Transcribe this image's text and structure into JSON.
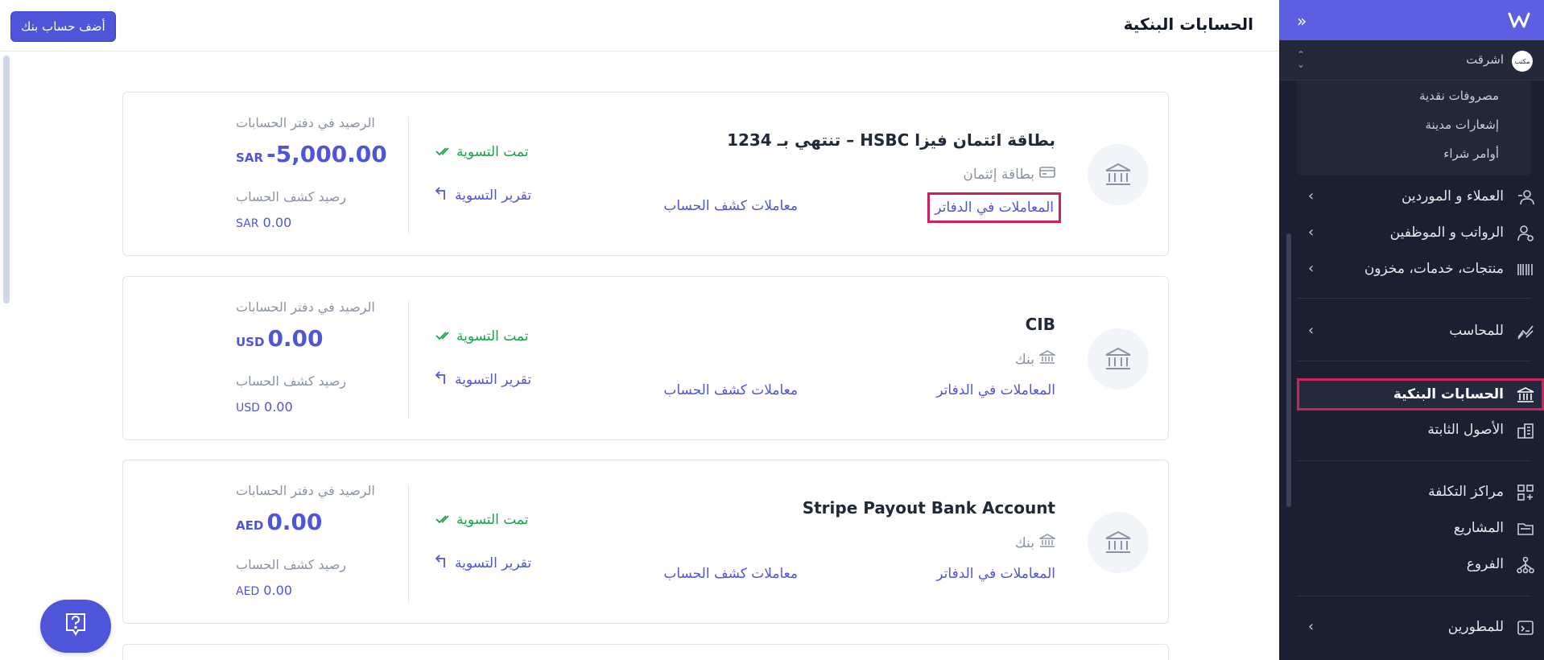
{
  "header": {
    "title": "الحسابات البنكية",
    "add_button": "أضف حساب بنك"
  },
  "accounts": [
    {
      "name": "بطاقة ائتمان فيزا HSBC – تنتهي بـ 1234",
      "type": "بطاقة إئتمان",
      "type_icon": "credit-card-icon",
      "books_link": "المعاملات في الدفاتر",
      "statement_link": "معاملات كشف الحساب",
      "reconciled": "تمت التسوية",
      "recon_report": "تقرير التسوية",
      "books_balance_label": "الرصيد في دفتر الحسابات",
      "books_balance_amount": "-5,000.00",
      "books_balance_currency": "SAR",
      "statement_balance_label": "رصيد كشف الحساب",
      "statement_balance_amount": "0.00",
      "statement_balance_currency": "SAR"
    },
    {
      "name": "CIB",
      "type": "بنك",
      "type_icon": "bank-icon",
      "books_link": "المعاملات في الدفاتر",
      "statement_link": "معاملات كشف الحساب",
      "reconciled": "تمت التسوية",
      "recon_report": "تقرير التسوية",
      "books_balance_label": "الرصيد في دفتر الحسابات",
      "books_balance_amount": "0.00",
      "books_balance_currency": "USD",
      "statement_balance_label": "رصيد كشف الحساب",
      "statement_balance_amount": "0.00",
      "statement_balance_currency": "USD"
    },
    {
      "name": "Stripe Payout Bank Account",
      "type": "بنك",
      "type_icon": "bank-icon",
      "books_link": "المعاملات في الدفاتر",
      "statement_link": "معاملات كشف الحساب",
      "reconciled": "تمت التسوية",
      "recon_report": "تقرير التسوية",
      "books_balance_label": "الرصيد في دفتر الحسابات",
      "books_balance_amount": "0.00",
      "books_balance_currency": "AED",
      "statement_balance_label": "رصيد كشف الحساب",
      "statement_balance_amount": "0.00",
      "statement_balance_currency": "AED"
    }
  ],
  "sidebar": {
    "company": {
      "name": "اشرقت",
      "avatar": "مكتب"
    },
    "submenu": [
      "مصروفات نقدية",
      "إشعارات مدينة",
      "أوامر شراء"
    ],
    "items": [
      {
        "label": "العملاء و الموردين",
        "icon": "users-icon",
        "has_chevron": true
      },
      {
        "label": "الرواتب و الموظفين",
        "icon": "employees-icon",
        "has_chevron": true
      },
      {
        "label": "منتجات، خدمات، مخزون",
        "icon": "barcode-icon",
        "has_chevron": true
      },
      {
        "label": "للمحاسب",
        "icon": "chart-icon",
        "has_chevron": true
      },
      {
        "label": "الحسابات البنكية",
        "icon": "bank-icon",
        "has_chevron": false,
        "active": true
      },
      {
        "label": "الأصول الثابتة",
        "icon": "building-icon",
        "has_chevron": false
      },
      {
        "label": "مراكز التكلفة",
        "icon": "grid-plus-icon",
        "has_chevron": false
      },
      {
        "label": "المشاريع",
        "icon": "folder-icon",
        "has_chevron": false
      },
      {
        "label": "الفروع",
        "icon": "branches-icon",
        "has_chevron": false
      },
      {
        "label": "للمطورين",
        "icon": "terminal-icon",
        "has_chevron": true
      }
    ]
  },
  "colors": {
    "accent": "#4f55d9",
    "success": "#16a34a",
    "highlight": "#d11f5a",
    "sidebar_bg": "#1b2031"
  }
}
